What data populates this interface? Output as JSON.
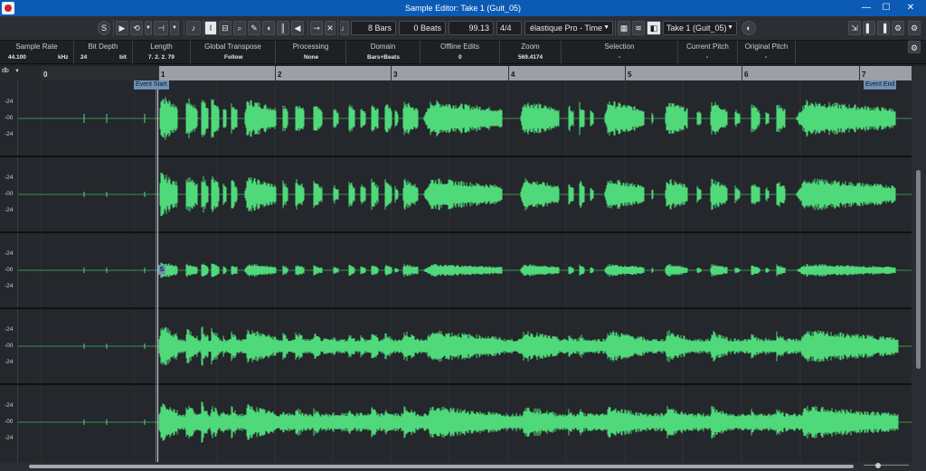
{
  "window": {
    "title": "Sample Editor: Take 1 (Guit_05)",
    "controls": [
      "—",
      "☐",
      "✕"
    ]
  },
  "toolbar": {
    "solo_label": "S",
    "play_label": "▶",
    "loop_label": "⟲",
    "audition_volume_label": "⊣",
    "length_value": "8 Bars",
    "beats_value": "0 Beats",
    "tempo_value": "99.13",
    "signature_value": "4/4",
    "algorithm_value": "élastique Pro - Time",
    "take_value": "Take 1 (Guit_05)",
    "dropdown_glyph": "▼"
  },
  "info": {
    "columns": [
      {
        "label": "Sample Rate",
        "values": [
          "44.100",
          "kHz"
        ]
      },
      {
        "label": "Bit Depth",
        "values": [
          "24",
          "bit"
        ]
      },
      {
        "label": "Length",
        "values": [
          "7. 2. 2. 79"
        ]
      },
      {
        "label": "Global Transpose",
        "values": [
          "Follow"
        ]
      },
      {
        "label": "Processing",
        "values": [
          "None"
        ]
      },
      {
        "label": "Domain",
        "values": [
          "Bars+Beats"
        ]
      },
      {
        "label": "Offline Edits",
        "values": [
          "0"
        ]
      },
      {
        "label": "Zoom",
        "values": [
          "569.4174"
        ]
      },
      {
        "label": "Selection",
        "values": [
          "-"
        ]
      },
      {
        "label": "Current Pitch",
        "values": [
          "-"
        ]
      },
      {
        "label": "Original Pitch",
        "values": [
          "-"
        ]
      }
    ]
  },
  "ruler": {
    "db_label": "db",
    "zero_label": "0",
    "bars": [
      "1",
      "2",
      "3",
      "4",
      "5",
      "6",
      "7"
    ]
  },
  "waveform": {
    "db_ticks": [
      "-24",
      "-00",
      "-24"
    ],
    "event_start": "Event Start",
    "event_end": "Event End",
    "start_marker": "S",
    "lanes": 5,
    "wave_color": "#4fd97a"
  },
  "colors": {
    "titlebar": "#0b5bb5",
    "background": "#24272b",
    "waveform": "#4fd97a",
    "event_flag": "#6f8fb5"
  }
}
